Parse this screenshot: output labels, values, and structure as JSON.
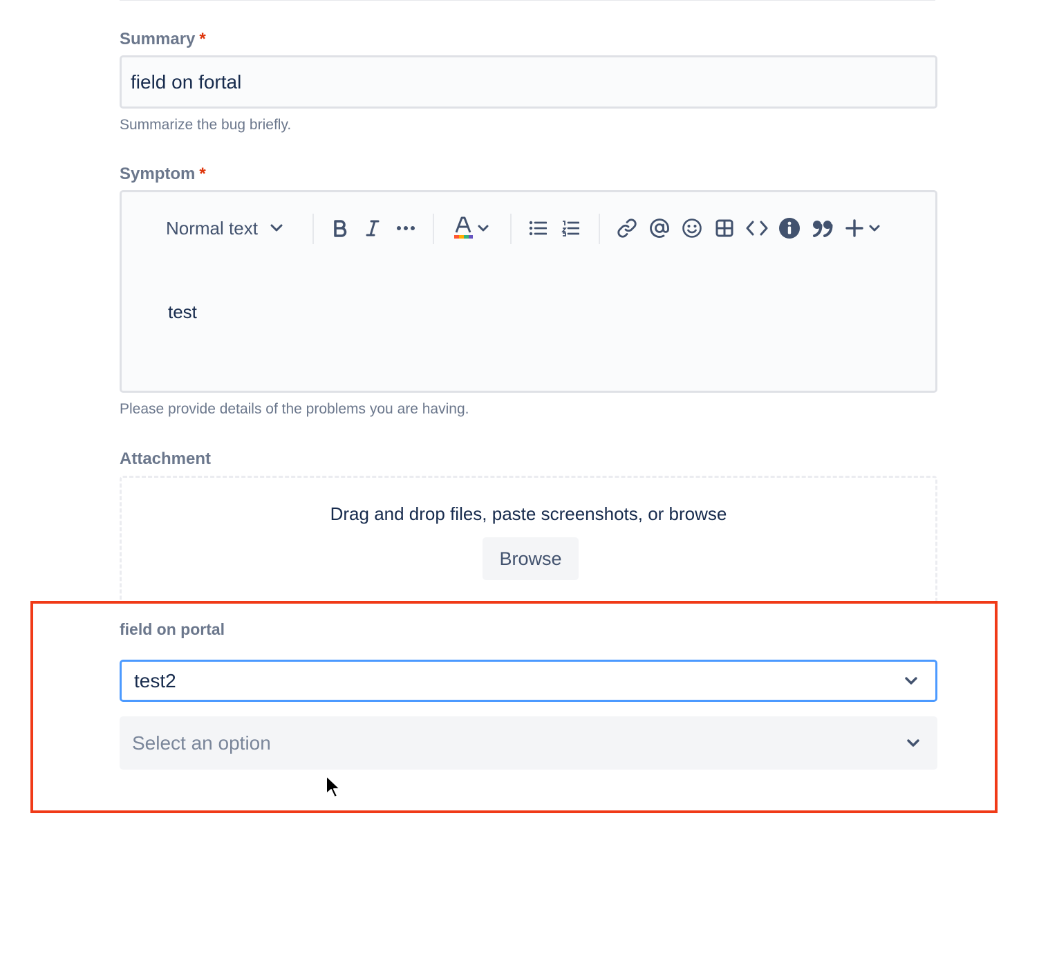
{
  "summary": {
    "label": "Summary",
    "required_mark": "*",
    "value": "field on fortal",
    "helper": "Summarize the bug briefly."
  },
  "symptom": {
    "label": "Symptom",
    "required_mark": "*",
    "toolbar": {
      "text_style": "Normal text",
      "buttons": [
        "chevron-down-icon",
        "bold-icon",
        "italic-icon",
        "more-icon",
        "text-color-icon",
        "bullet-list-icon",
        "numbered-list-icon",
        "link-icon",
        "mention-icon",
        "emoji-icon",
        "table-icon",
        "code-icon",
        "info-icon",
        "quote-icon",
        "plus-icon"
      ]
    },
    "content": "test",
    "helper": "Please provide details of the problems you are having."
  },
  "attachment": {
    "label": "Attachment",
    "drop_text": "Drag and drop files, paste screenshots, or browse",
    "browse_label": "Browse"
  },
  "portal_field": {
    "label": "field on portal",
    "selected_value": "test2",
    "second_placeholder": "Select an option"
  },
  "colors": {
    "required": "#de350b",
    "focus_border": "#4c9aff",
    "highlight_border": "#f03a17",
    "label": "#6b778c"
  }
}
